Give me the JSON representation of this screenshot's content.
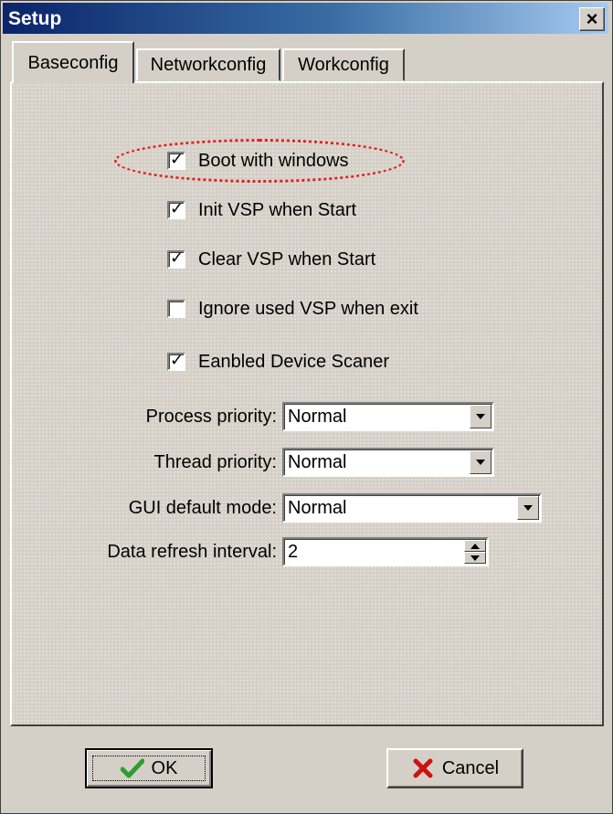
{
  "window": {
    "title": "Setup",
    "close_glyph": "×"
  },
  "tabs": [
    {
      "label": "Baseconfig",
      "active": true
    },
    {
      "label": "Networkconfig",
      "active": false
    },
    {
      "label": "Workconfig",
      "active": false
    }
  ],
  "checkboxes": [
    {
      "label": "Boot with windows",
      "checked": true,
      "highlighted": true
    },
    {
      "label": "Init VSP when Start",
      "checked": true
    },
    {
      "label": "Clear VSP when Start",
      "checked": true
    },
    {
      "label": "Ignore used VSP when exit",
      "checked": false
    },
    {
      "label": "Eanbled Device Scaner",
      "checked": true
    }
  ],
  "fields": {
    "process_priority": {
      "label": "Process priority:",
      "value": "Normal"
    },
    "thread_priority": {
      "label": "Thread priority:",
      "value": "Normal"
    },
    "gui_default_mode": {
      "label": "GUI default mode:",
      "value": "Normal"
    },
    "data_refresh_interval": {
      "label": "Data refresh interval:",
      "value": "2"
    }
  },
  "buttons": {
    "ok": "OK",
    "cancel": "Cancel"
  },
  "icons": {
    "ok": "checkmark-icon",
    "cancel": "x-icon"
  },
  "colors": {
    "title_bar": "#0a246a",
    "highlight": "#e02020",
    "ok_icon": "#2e9e2e",
    "cancel_icon": "#cc1111"
  }
}
